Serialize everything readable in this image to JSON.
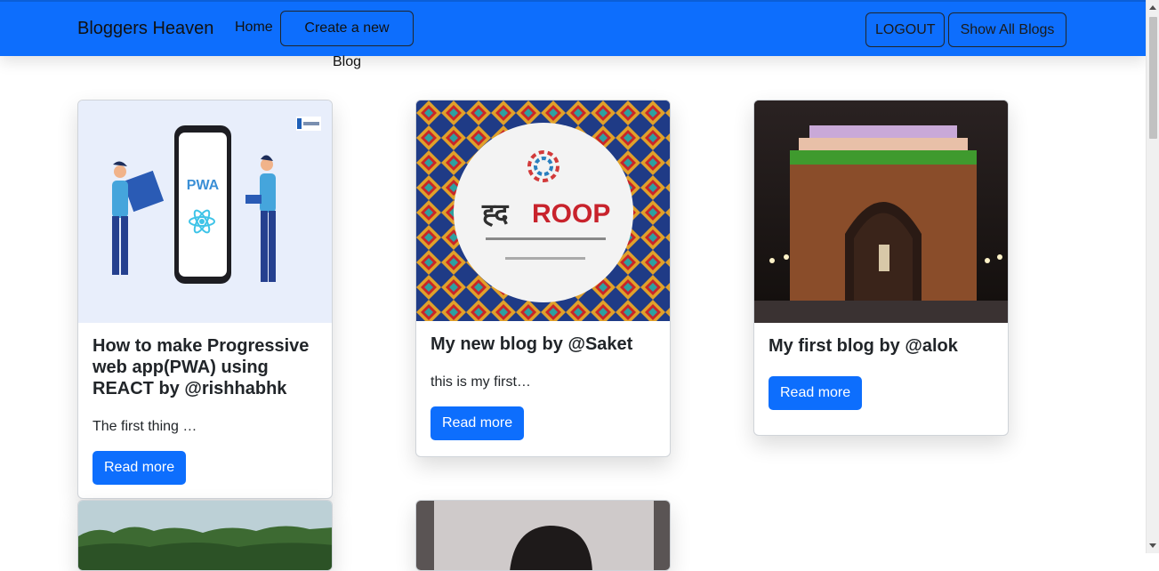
{
  "navbar": {
    "brand": "Bloggers Heaven",
    "home": "Home",
    "create": "Create a new Blog",
    "logout": "LOGOUT",
    "show_all": "Show All Blogs"
  },
  "cards": [
    {
      "title": "How to make Progressive web app(PWA) using REACT by @rishhabhk",
      "text": "The first thing …",
      "button": "Read more",
      "image_text": "PWA"
    },
    {
      "title": "My new blog by @Saket",
      "text": "this is my first…",
      "button": "Read more",
      "image_text": "ROOP"
    },
    {
      "title": "My first blog by @alok",
      "button": "Read more"
    }
  ],
  "colors": {
    "navbar": "#0d6efd",
    "button": "#0d6efd"
  }
}
